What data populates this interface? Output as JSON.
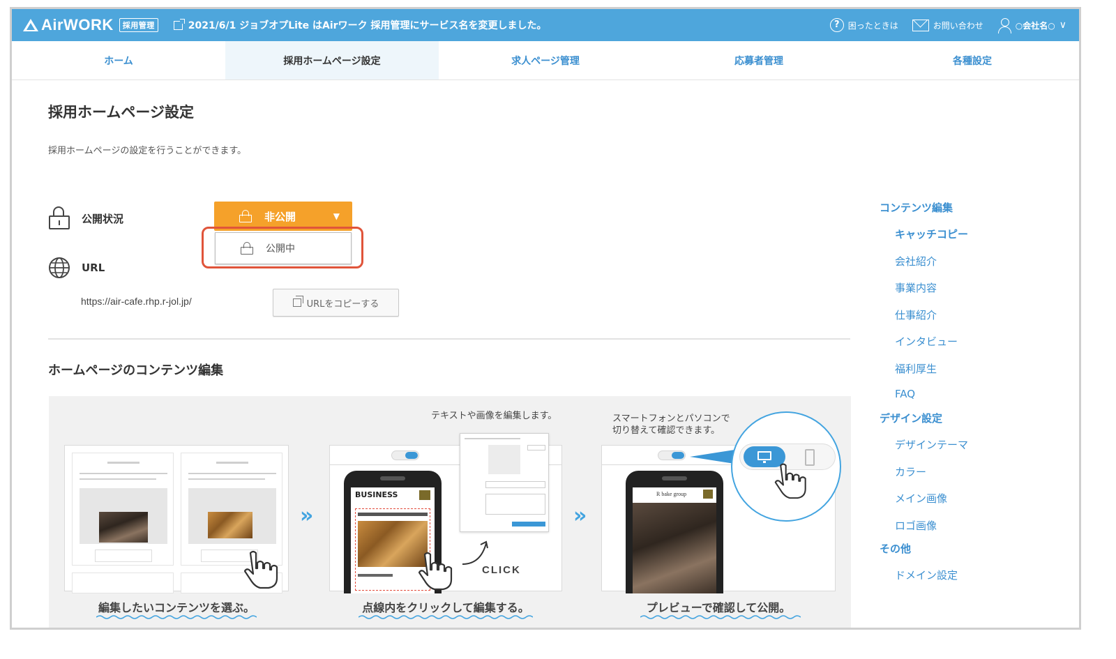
{
  "header": {
    "logo_text": "AirWORK",
    "logo_badge": "採用管理",
    "notice": "2021/6/1 ジョブオプLite はAirワーク 採用管理にサービス名を変更しました。",
    "help_label": "困ったときは",
    "contact_label": "お問い合わせ",
    "account_label": "○会社名○"
  },
  "tabs": [
    {
      "label": "ホーム",
      "active": false
    },
    {
      "label": "採用ホームページ設定",
      "active": true
    },
    {
      "label": "求人ページ管理",
      "active": false
    },
    {
      "label": "応募者管理",
      "active": false
    },
    {
      "label": "各種設定",
      "active": false
    }
  ],
  "page": {
    "title": "採用ホームページ設定",
    "description": "採用ホームページの設定を行うことができます。"
  },
  "status": {
    "label": "公開状況",
    "button_label": "非公開",
    "dropdown_option": "公開中"
  },
  "url": {
    "label": "URL",
    "value": "https://air-cafe.rhp.r-jol.jp/",
    "copy_label": "URLをコピーする"
  },
  "contents_section": {
    "title": "ホームページのコンテンツ編集",
    "step1_caption": "編集したいコンテンツを選ぶ。",
    "step2_caption": "点線内をクリックして編集する。",
    "step3_caption": "プレビューで確認して公開。",
    "step2_note": "テキストや画像を編集します。",
    "step3_note_line1": "スマートフォンとパソコンで",
    "step3_note_line2": "切り替えて確認できます。",
    "click_label": "CLICK",
    "business_label": "BUSINESS",
    "bakery_label": "R bake group"
  },
  "side_nav": {
    "groups": [
      {
        "heading": "コンテンツ編集",
        "items": [
          "キャッチコピー",
          "会社紹介",
          "事業内容",
          "仕事紹介",
          "インタビュー",
          "福利厚生",
          "FAQ"
        ]
      },
      {
        "heading": "デザイン設定",
        "items": [
          "デザインテーマ",
          "カラー",
          "メイン画像",
          "ロゴ画像"
        ]
      },
      {
        "heading": "その他",
        "items": [
          "ドメイン設定"
        ]
      }
    ]
  },
  "colors": {
    "header_bg": "#4ea6dc",
    "link": "#3b8fd0",
    "status_button": "#f5a12a",
    "highlight": "#e0543a"
  }
}
